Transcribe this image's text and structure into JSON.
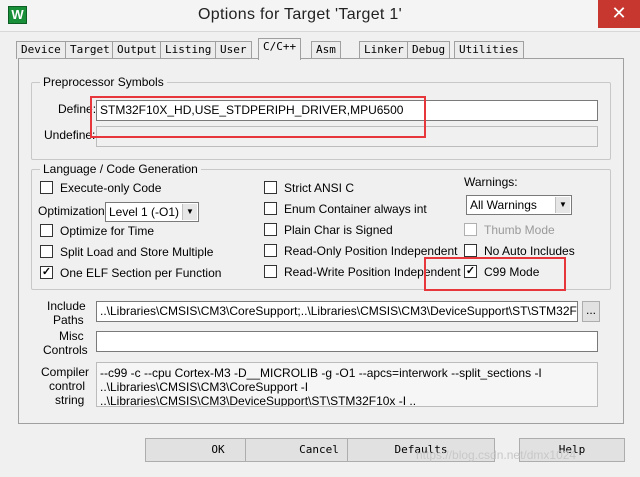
{
  "window": {
    "title": "Options for Target 'Target 1'",
    "app_icon": "W",
    "close_glyph": "✕"
  },
  "tabs": [
    "Device",
    "Target",
    "Output",
    "Listing",
    "User",
    "C/C++",
    "Asm",
    "Linker",
    "Debug",
    "Utilities"
  ],
  "active_tab": "C/C++",
  "preprocessor": {
    "group_title": "Preprocessor Symbols",
    "define_label": "Define:",
    "define_value": "STM32F10X_HD,USE_STDPERIPH_DRIVER,MPU6500",
    "undefine_label": "Undefine:",
    "undefine_value": ""
  },
  "language": {
    "group_title": "Language / Code Generation",
    "execute_only": "Execute-only Code",
    "optimization_label": "Optimization:",
    "optimization_value": "Level 1 (-O1)",
    "optimize_time": "Optimize for Time",
    "split_load": "Split Load and Store Multiple",
    "one_elf": "One ELF Section per Function",
    "strict_ansi": "Strict ANSI C",
    "enum_container": "Enum Container always int",
    "plain_char": "Plain Char is Signed",
    "ro_pos": "Read-Only Position Independent",
    "rw_pos": "Read-Write Position Independent",
    "warnings_label": "Warnings:",
    "warnings_value": "All Warnings",
    "thumb_mode": "Thumb Mode",
    "no_auto_includes": "No Auto Includes",
    "c99_mode": "C99 Mode",
    "check_glyph": "✓"
  },
  "paths": {
    "include_label_1": "Include",
    "include_label_2": "Paths",
    "include_value": "..\\Libraries\\CMSIS\\CM3\\CoreSupport;..\\Libraries\\CMSIS\\CM3\\DeviceSupport\\ST\\STM32F10x;..\\Li",
    "browse": "...",
    "misc_label_1": "Misc",
    "misc_label_2": "Controls",
    "misc_value": "",
    "compiler_label_1": "Compiler",
    "compiler_label_2": "control",
    "compiler_label_3": "string",
    "compiler_value": "--c99 -c --cpu Cortex-M3 -D__MICROLIB -g -O1 --apcs=interwork --split_sections -I ..\\Libraries\\CMSIS\\CM3\\CoreSupport -I ..\\Libraries\\CMSIS\\CM3\\DeviceSupport\\ST\\STM32F10x -I .."
  },
  "buttons": {
    "ok": "OK",
    "cancel": "Cancel",
    "defaults": "Defaults",
    "help": "Help"
  },
  "watermark": "https://blog.csdn.net/dmx1024",
  "colors": {
    "highlight": "#e8363d",
    "close": "#c7372f"
  }
}
